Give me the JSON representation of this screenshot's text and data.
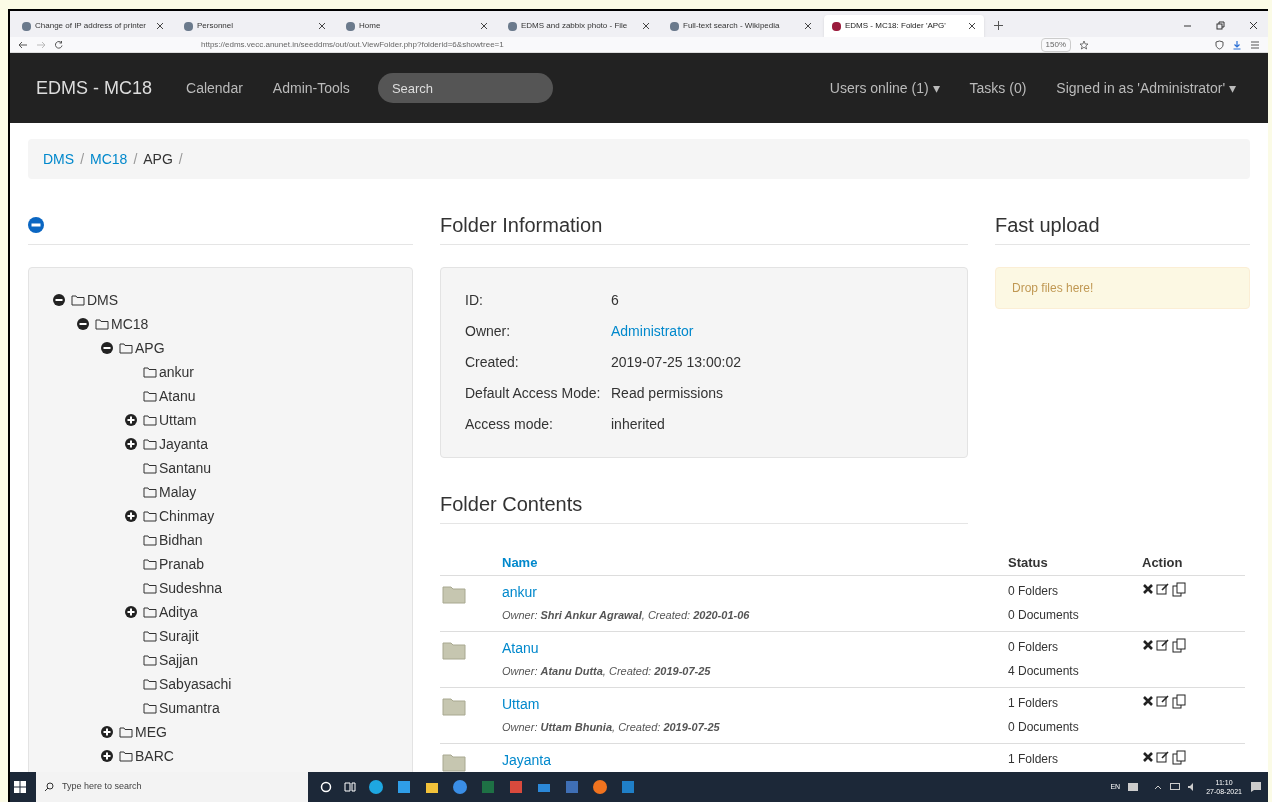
{
  "browser": {
    "tabs": [
      {
        "title": "Change of IP address of printer",
        "selected": false
      },
      {
        "title": "Personnel",
        "selected": false
      },
      {
        "title": "Home",
        "selected": false
      },
      {
        "title": "EDMS and zabbix photo - File",
        "selected": false
      },
      {
        "title": "Full-text search - Wikipedia",
        "selected": false
      },
      {
        "title": "EDMS - MC18: Folder 'APG'",
        "selected": true
      }
    ],
    "url": "https://edms.vecc.anunet.in/seeddms/out/out.ViewFolder.php?folderid=6&showtree=1",
    "zoom": "150%"
  },
  "navbar": {
    "brand": "EDMS - MC18",
    "links": [
      "Calendar",
      "Admin-Tools"
    ],
    "search": {
      "placeholder": "Search"
    },
    "right": [
      "Users online (1) ▾",
      "Tasks (0)",
      "Signed in as 'Administrator' ▾"
    ]
  },
  "breadcrumb": [
    "DMS",
    "MC18",
    "APG"
  ],
  "breadcrumb_separator": "/",
  "tree": [
    {
      "label": "DMS",
      "expanded": true,
      "children": [
        {
          "label": "MC18",
          "expanded": true,
          "children": [
            {
              "label": "APG",
              "expanded": true,
              "children": [
                {
                  "label": "ankur"
                },
                {
                  "label": "Atanu"
                },
                {
                  "label": "Uttam",
                  "expanded": false
                },
                {
                  "label": "Jayanta",
                  "expanded": false
                },
                {
                  "label": "Santanu"
                },
                {
                  "label": "Malay"
                },
                {
                  "label": "Chinmay",
                  "expanded": false
                },
                {
                  "label": "Bidhan"
                },
                {
                  "label": "Pranab"
                },
                {
                  "label": "Sudeshna"
                },
                {
                  "label": "Aditya",
                  "expanded": false
                },
                {
                  "label": "Surajit"
                },
                {
                  "label": "Sajjan"
                },
                {
                  "label": "Sabyasachi"
                },
                {
                  "label": "Sumantra"
                }
              ]
            },
            {
              "label": "MEG",
              "expanded": false
            },
            {
              "label": "BARC",
              "expanded": false
            }
          ]
        }
      ]
    }
  ],
  "folder_information": {
    "title": "Folder Information",
    "fields": [
      {
        "label": "ID:",
        "value": "6",
        "kind": "text"
      },
      {
        "label": "Owner:",
        "value": "Administrator",
        "kind": "link"
      },
      {
        "label": "Created:",
        "value": "2019-07-25 13:00:02",
        "kind": "text"
      },
      {
        "label": "Default Access Mode:",
        "value": "Read permissions",
        "kind": "text"
      },
      {
        "label": "Access mode:",
        "value": "inherited",
        "kind": "text"
      }
    ]
  },
  "fast_upload": {
    "title": "Fast upload",
    "drop_hint": "Drop files here!"
  },
  "folder_contents": {
    "title": "Folder Contents",
    "columns": [
      "Name",
      "Status",
      "Action"
    ],
    "rows": [
      {
        "name": "ankur",
        "meta": "Owner: **Shri Ankur Agrawal**, Created: **2020-01-06**",
        "folders": "0 Folders",
        "documents": "0 Documents"
      },
      {
        "name": "Atanu",
        "meta": "Owner: **Atanu Dutta**, Created: **2019-07-25**",
        "folders": "0 Folders",
        "documents": "4 Documents"
      },
      {
        "name": "Uttam",
        "meta": "Owner: **Uttam Bhunia**, Created: **2019-07-25**",
        "folders": "1 Folders",
        "documents": "0 Documents"
      },
      {
        "name": "Jayanta",
        "folders": "1 Folders"
      }
    ]
  },
  "taskbar": {
    "search": {
      "placeholder": "Type here to search"
    },
    "language": "EN",
    "time": "11:10",
    "date": "27-08-2021"
  }
}
